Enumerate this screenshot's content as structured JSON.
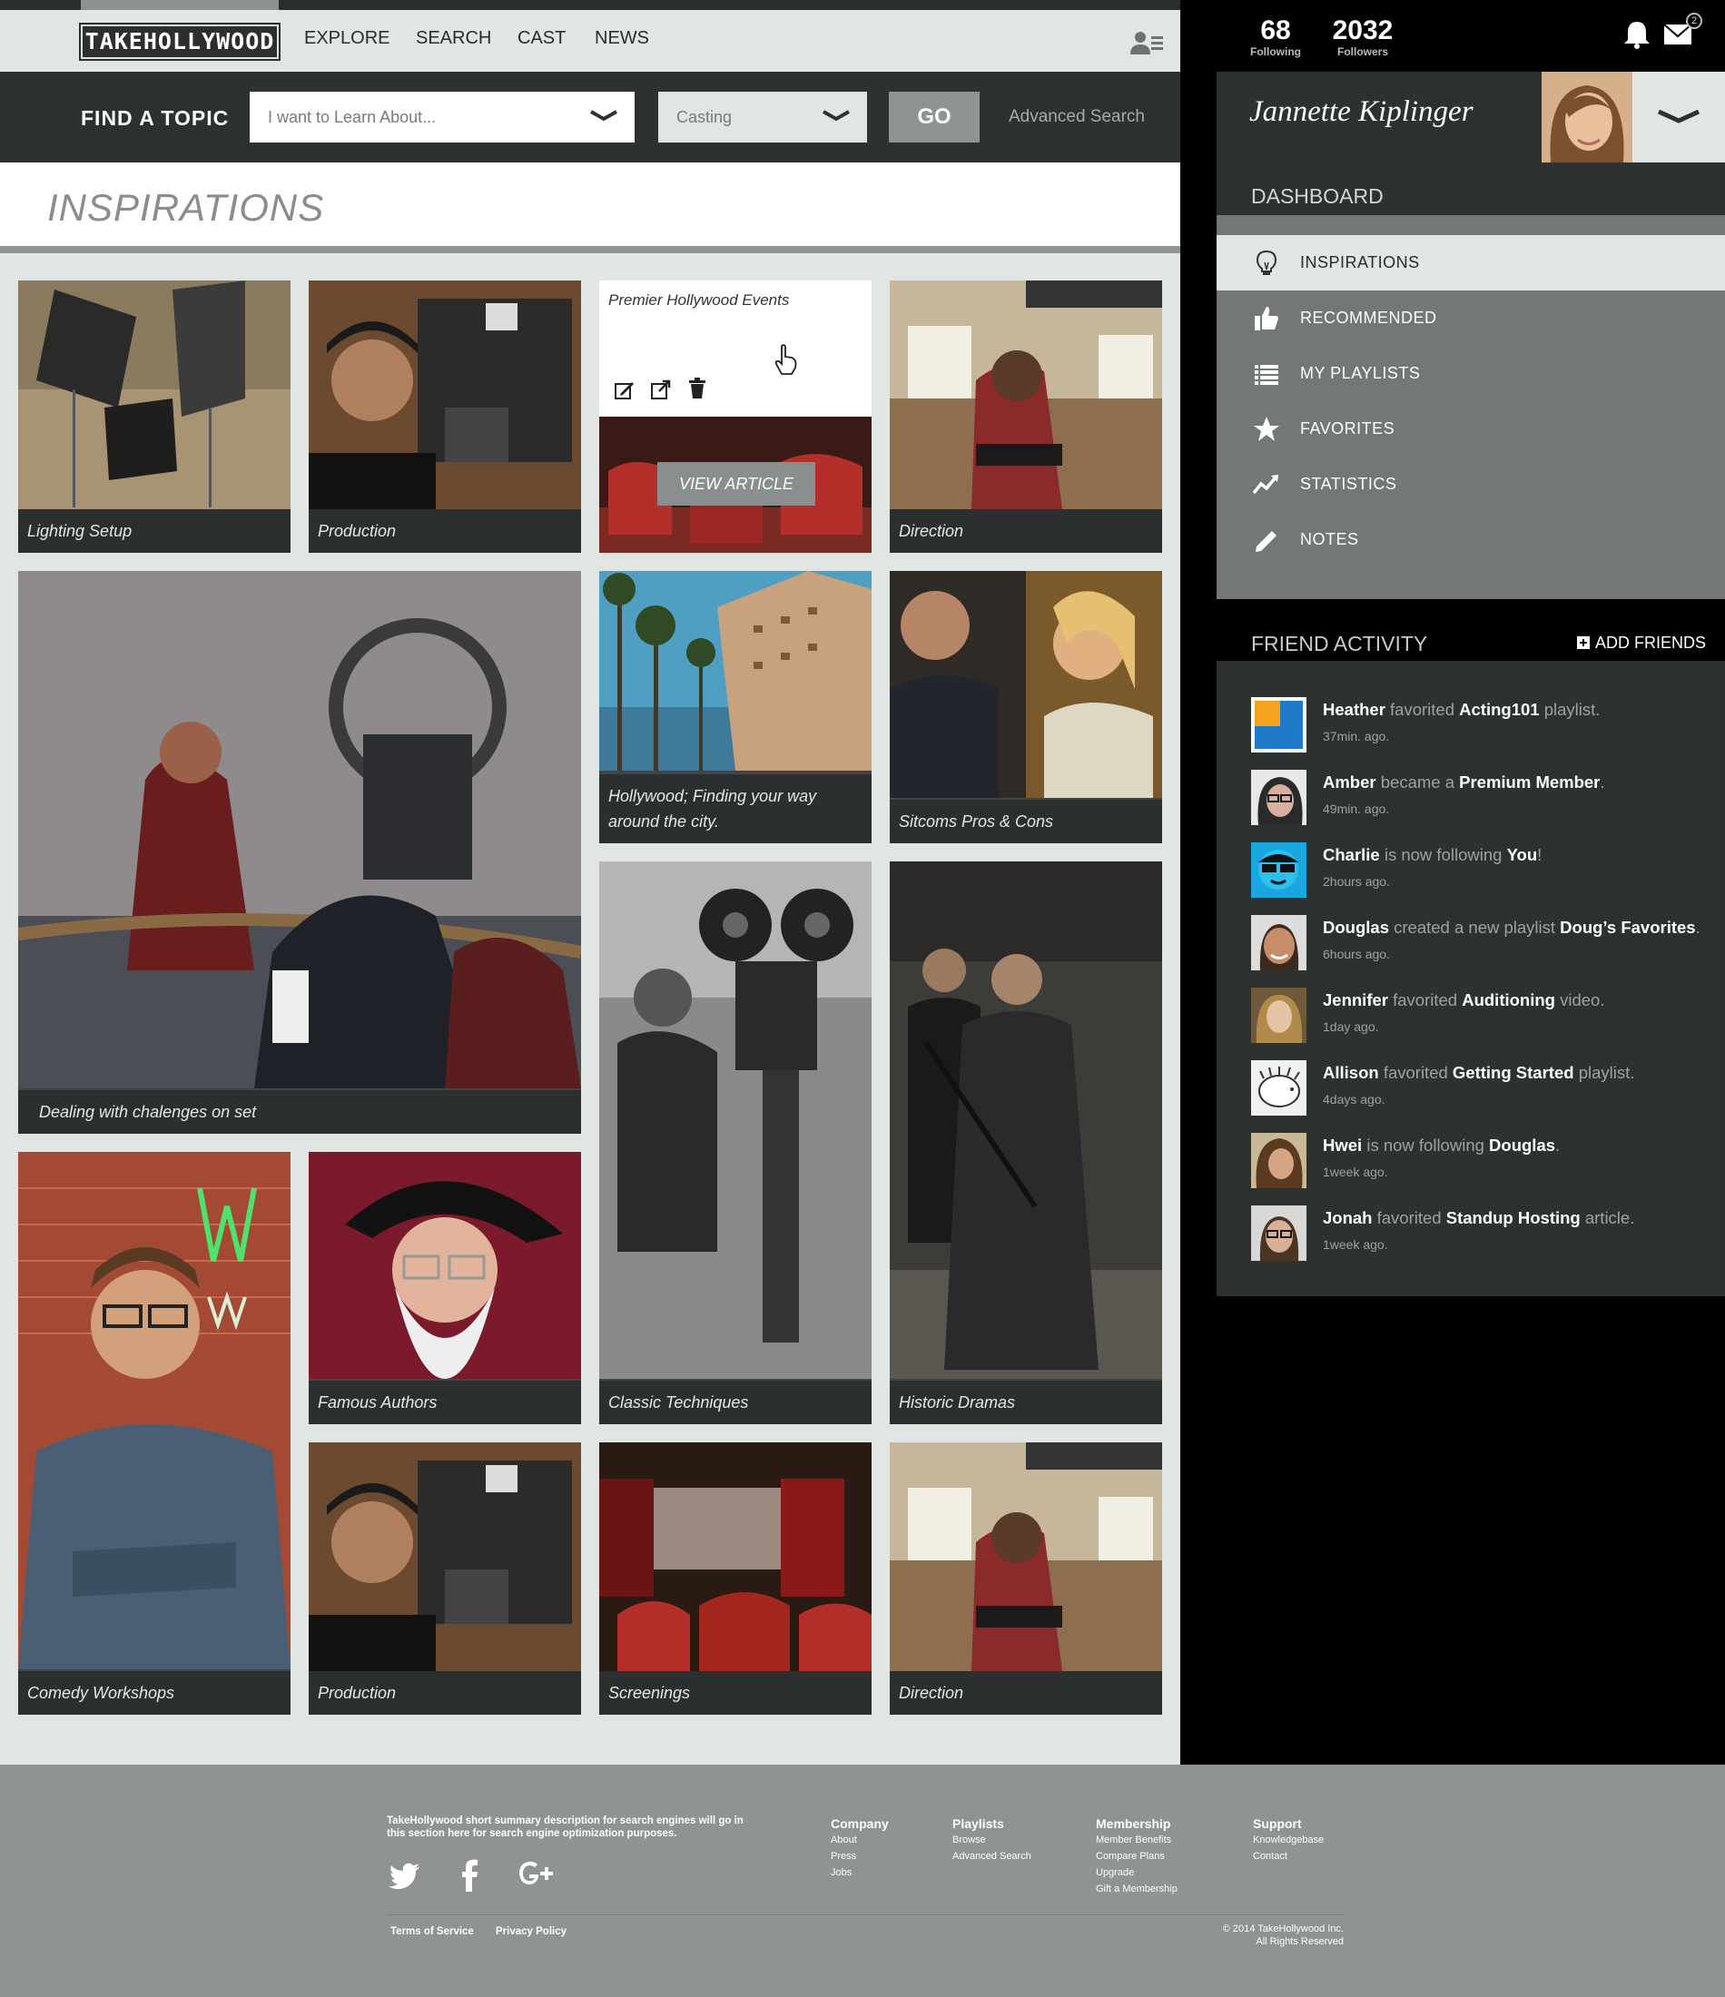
{
  "header": {
    "logo": "TAKEHOLLYWOOD",
    "nav": [
      "EXPLORE",
      "SEARCH",
      "CAST",
      "NEWS"
    ]
  },
  "find_bar": {
    "label": "FIND A TOPIC",
    "topic_placeholder": "I want to Learn About...",
    "category_value": "Casting",
    "go_label": "GO",
    "advanced_label": "Advanced Search"
  },
  "page": {
    "title": "INSPIRATIONS"
  },
  "tiles": [
    {
      "caption": "Lighting Setup"
    },
    {
      "caption": "Production"
    },
    {
      "caption": "Premier Hollywood Events",
      "button": "VIEW ARTICLE"
    },
    {
      "caption": "Direction"
    },
    {
      "caption": "Dealing with chalenges on set"
    },
    {
      "caption": "Hollywood; Finding your way around the city."
    },
    {
      "caption": "Sitcoms Pros & Cons"
    },
    {
      "caption": "Classic Techniques"
    },
    {
      "caption": "Historic Dramas"
    },
    {
      "caption": "Comedy Workshops"
    },
    {
      "caption": "Famous Authors"
    },
    {
      "caption": "Production"
    },
    {
      "caption": "Screenings"
    },
    {
      "caption": "Direction"
    }
  ],
  "stats": {
    "following": "68",
    "following_label": "Following",
    "followers": "2032",
    "followers_label": "Followers",
    "mail_count": "2"
  },
  "user": {
    "name": "Jannette Kiplinger"
  },
  "dashboard": {
    "title": "DASHBOARD",
    "items": [
      "INSPIRATIONS",
      "RECOMMENDED",
      "MY PLAYLISTS",
      "FAVORITES",
      "STATISTICS",
      "NOTES"
    ]
  },
  "friend_activity": {
    "title": "FRIEND ACTIVITY",
    "add_label": "ADD FRIENDS",
    "items": [
      {
        "name": "Heather",
        "action": "favorited",
        "target": "Acting101",
        "suffix": "playlist.",
        "ago": "37min. ago."
      },
      {
        "name": "Amber",
        "action": "became a",
        "target": "Premium Member",
        "suffix": ".",
        "ago": "49min. ago."
      },
      {
        "name": "Charlie",
        "action": "is now following",
        "target": "You",
        "suffix": "!",
        "ago": "2hours ago."
      },
      {
        "name": "Douglas",
        "action": "created a new playlist",
        "target": "Doug’s Favorites",
        "suffix": ".",
        "ago": "6hours ago."
      },
      {
        "name": "Jennifer",
        "action": "favorited",
        "target": "Auditioning",
        "suffix": "video.",
        "ago": "1day ago."
      },
      {
        "name": "Allison",
        "action": "favorited",
        "target": "Getting Started",
        "suffix": "playlist.",
        "ago": "4days ago."
      },
      {
        "name": "Hwei",
        "action": "is now following",
        "target": "Douglas",
        "suffix": ".",
        "ago": "1week ago."
      },
      {
        "name": "Jonah",
        "action": "favorited",
        "target": "Standup Hosting",
        "suffix": "article.",
        "ago": "1week ago."
      }
    ]
  },
  "footer": {
    "description": "TakeHollywood short summary description for  search engines will go in this section here for search engine optimization purposes.",
    "columns": [
      {
        "title": "Company",
        "links": [
          "About",
          "Press",
          "Jobs"
        ]
      },
      {
        "title": "Playlists",
        "links": [
          "Browse",
          "Advanced Search"
        ]
      },
      {
        "title": "Membership",
        "links": [
          "Member Benefits",
          "Compare Plans",
          "Upgrade",
          "Gift a Membership"
        ]
      },
      {
        "title": "Support",
        "links": [
          "Knowledgebase",
          "Contact"
        ]
      }
    ],
    "terms": "Terms of Service",
    "privacy": "Privacy Policy",
    "copyright_1": "© 2014 TakeHollywood Inc.",
    "copyright_2": "All Rights Reserved"
  }
}
